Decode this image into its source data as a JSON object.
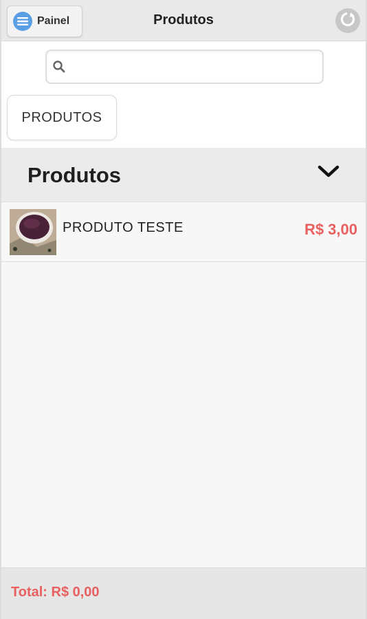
{
  "header": {
    "menu_label": "Painel",
    "title": "Produtos",
    "menu_icon": "hamburger-menu-icon",
    "refresh_icon": "refresh-icon"
  },
  "search": {
    "placeholder": "",
    "value": "",
    "icon": "search-icon"
  },
  "categories": [
    {
      "label": "PRODUTOS"
    }
  ],
  "section": {
    "title": "Produtos",
    "toggle_icon": "chevron-down-icon"
  },
  "products": [
    {
      "name": "PRODUTO TESTE",
      "price": "R$ 3,00",
      "image": "acai-bowl-thumbnail"
    }
  ],
  "footer": {
    "total": "Total: R$ 0,00"
  },
  "colors": {
    "accent": "#e8605f",
    "menu_icon_bg": "#5a9fe4",
    "header_bg": "#e9e9e9"
  }
}
